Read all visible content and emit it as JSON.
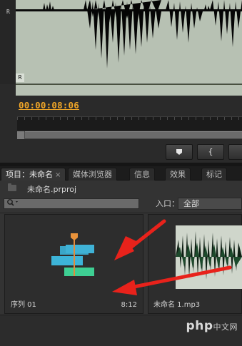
{
  "monitor": {
    "channel_top": "R",
    "channel_bottom": "R",
    "timecode": "00:00:08:06",
    "colors": {
      "timecode": "#f0a628",
      "waveform_bg": "#b7c1b3",
      "waveform": "#000000"
    }
  },
  "controls": {
    "marker_icon": "marker-icon",
    "in_point_label": "{",
    "out_point_label": "}"
  },
  "tabs": [
    {
      "label": "项目：未命名",
      "close": "×",
      "active": true
    },
    {
      "label": "媒体浏览器"
    },
    {
      "label": "信息"
    },
    {
      "label": "效果"
    },
    {
      "label": "标记"
    }
  ],
  "project": {
    "file_name": "未命名.prproj",
    "search_placeholder": "",
    "in_label": "入口：",
    "in_value": "全部"
  },
  "items": [
    {
      "name": "序列 01",
      "duration": "8:12",
      "icon": "sequence-icon"
    },
    {
      "name": "未命名 1.mp3",
      "icon": "audio-waveform-thumbnail"
    }
  ],
  "watermark": {
    "text": "php",
    "suffix": "中文网"
  },
  "annotation": {
    "arrow_color": "#e8221b"
  }
}
